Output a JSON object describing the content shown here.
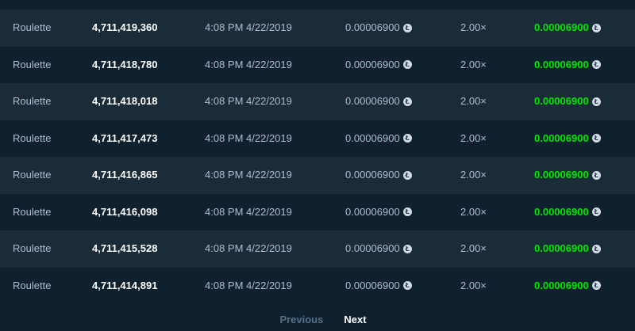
{
  "bets": [
    {
      "game": "Roulette",
      "bet_id": "4,711,419,360",
      "time": "4:08 PM 4/22/2019",
      "amount": "0.00006900",
      "multiplier": "2.00×",
      "payout": "0.00006900"
    },
    {
      "game": "Roulette",
      "bet_id": "4,711,418,780",
      "time": "4:08 PM 4/22/2019",
      "amount": "0.00006900",
      "multiplier": "2.00×",
      "payout": "0.00006900"
    },
    {
      "game": "Roulette",
      "bet_id": "4,711,418,018",
      "time": "4:08 PM 4/22/2019",
      "amount": "0.00006900",
      "multiplier": "2.00×",
      "payout": "0.00006900"
    },
    {
      "game": "Roulette",
      "bet_id": "4,711,417,473",
      "time": "4:08 PM 4/22/2019",
      "amount": "0.00006900",
      "multiplier": "2.00×",
      "payout": "0.00006900"
    },
    {
      "game": "Roulette",
      "bet_id": "4,711,416,865",
      "time": "4:08 PM 4/22/2019",
      "amount": "0.00006900",
      "multiplier": "2.00×",
      "payout": "0.00006900"
    },
    {
      "game": "Roulette",
      "bet_id": "4,711,416,098",
      "time": "4:08 PM 4/22/2019",
      "amount": "0.00006900",
      "multiplier": "2.00×",
      "payout": "0.00006900"
    },
    {
      "game": "Roulette",
      "bet_id": "4,711,415,528",
      "time": "4:08 PM 4/22/2019",
      "amount": "0.00006900",
      "multiplier": "2.00×",
      "payout": "0.00006900"
    },
    {
      "game": "Roulette",
      "bet_id": "4,711,414,891",
      "time": "4:08 PM 4/22/2019",
      "amount": "0.00006900",
      "multiplier": "2.00×",
      "payout": "0.00006900"
    }
  ],
  "pagination": {
    "previous_label": "Previous",
    "next_label": "Next"
  },
  "colors": {
    "background": "#0f212e",
    "row_alt": "#1a2c38",
    "text_muted": "#b1bad3",
    "payout_win": "#00e701"
  },
  "currency_icon": "litecoin-icon"
}
